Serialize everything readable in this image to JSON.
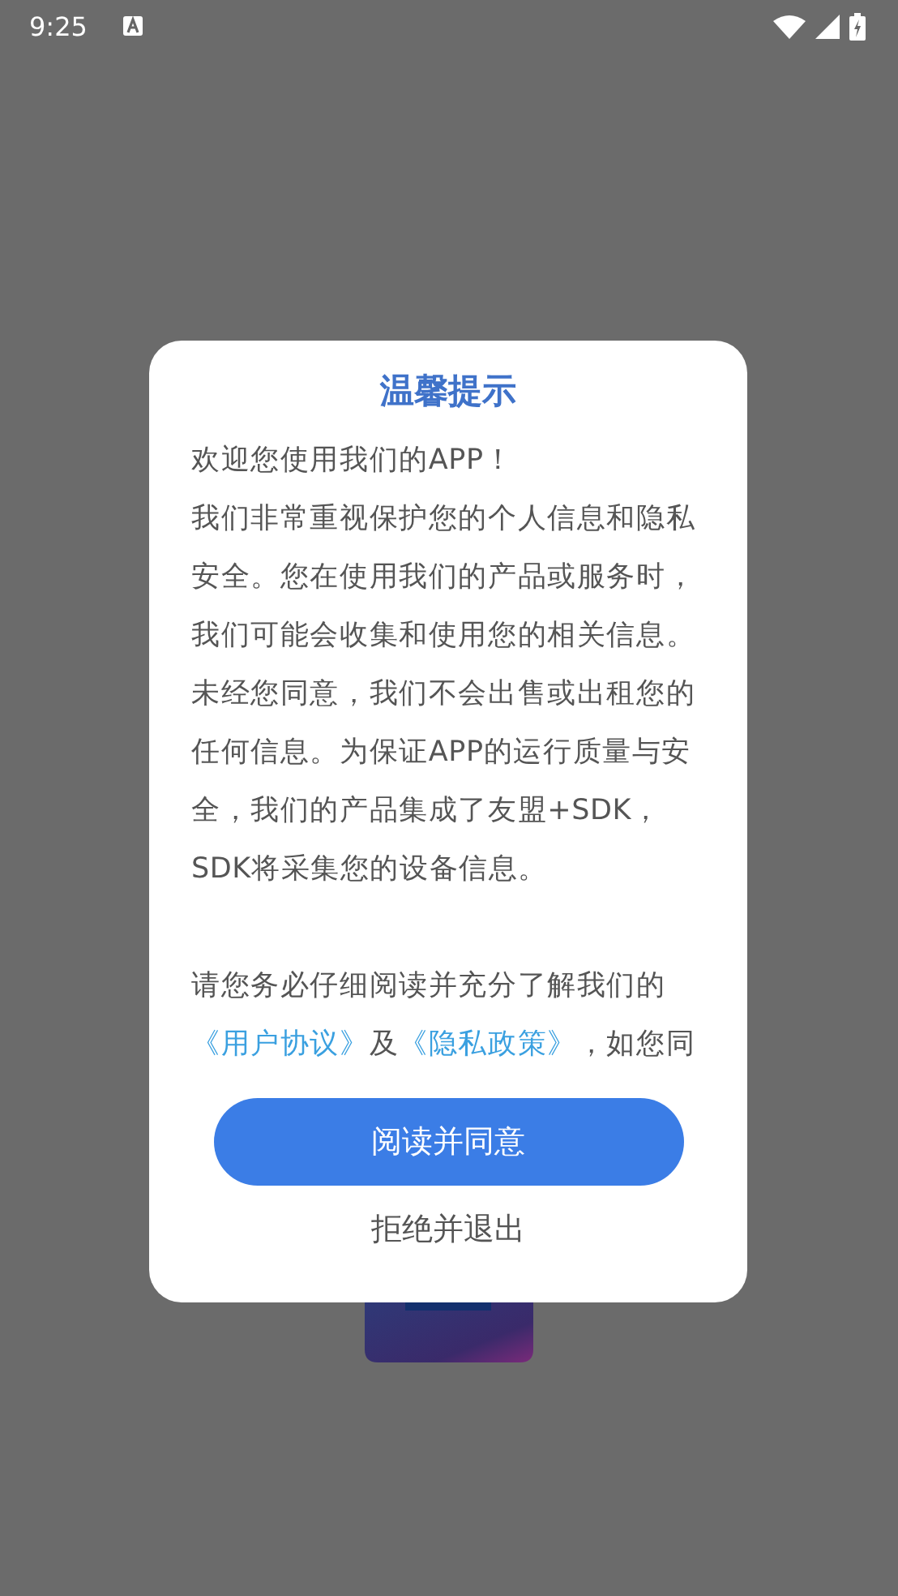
{
  "status_bar": {
    "time": "9:25"
  },
  "dialog": {
    "title": "温馨提示",
    "paragraphs": [
      "欢迎您使用我们的APP！",
      "我们非常重视保护您的个人信息和隐私安全。您在使用我们的产品或服务时，我们可能会收集和使用您的相关信息。未经您同意，我们不会出售或出租您的任何信息。为保证APP的运行质量与安全，我们的产品集成了友盟+SDK，SDK将采集您的设备信息。"
    ],
    "notice": [
      {
        "kind": "text",
        "text": "请您务必仔细阅读并充分了解我们的"
      },
      {
        "kind": "link",
        "text": "《用户协议》"
      },
      {
        "kind": "text",
        "text": "及"
      },
      {
        "kind": "link",
        "text": "《隐私政策》"
      },
      {
        "kind": "text",
        "text": "，如您同"
      }
    ],
    "buttons": [
      {
        "label": "阅读并同意",
        "kind": "primary"
      },
      {
        "label": "拒绝并退出",
        "kind": "plain"
      }
    ]
  }
}
